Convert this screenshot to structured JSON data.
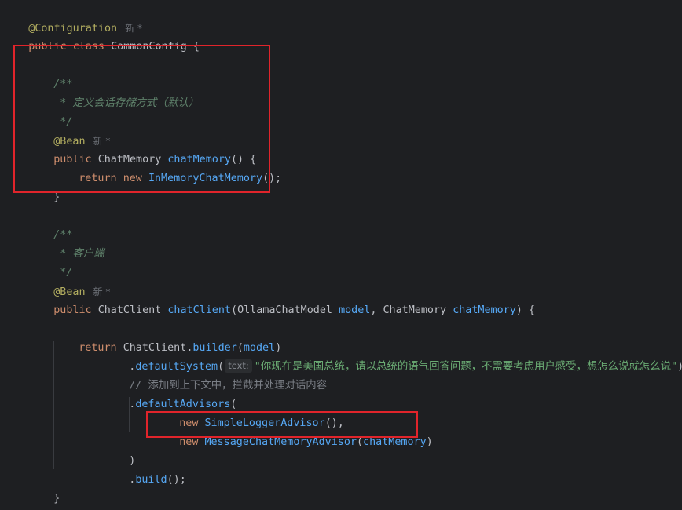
{
  "editor": {
    "line1": {
      "annotation": "@Configuration",
      "hint": "新 *"
    },
    "line2": {
      "kw_public": "public",
      "kw_class": "class",
      "class_name": "CommonConfig",
      "brace": "{"
    },
    "line3": {
      "doc": "/**"
    },
    "line4": {
      "doc": " * 定义会话存储方式（默认）"
    },
    "line5": {
      "doc": " */"
    },
    "line6": {
      "annotation": "@Bean",
      "hint": "新 *"
    },
    "line7": {
      "kw_public": "public",
      "type": "ChatMemory",
      "method": "chatMemory",
      "rest": "() {"
    },
    "line8": {
      "kw_return": "return",
      "kw_new": "new",
      "ctor": "InMemoryChatMemory",
      "rest": "();"
    },
    "line9": {
      "brace": "}"
    },
    "line10": {
      "doc": "/**"
    },
    "line11": {
      "doc": " * 客户端"
    },
    "line12": {
      "doc": " */"
    },
    "line13": {
      "annotation": "@Bean",
      "hint": "新 *"
    },
    "line14": {
      "kw_public": "public",
      "type": "ChatClient",
      "method": "chatClient",
      "open": "(",
      "param_type1": "OllamaChatModel",
      "param1": "model",
      "comma": ",",
      "param_type2": "ChatMemory",
      "param2": "chatMemory",
      "close": ") {"
    },
    "line15": {
      "kw_return": "return",
      "cls": "ChatClient",
      "dot": ".",
      "method": "builder",
      "open": "(",
      "arg": "model",
      "close": ")"
    },
    "line16": {
      "dot": ".",
      "method": "defaultSystem",
      "open": "(",
      "inlay": "text:",
      "string": "\"你现在是美国总统，请以总统的语气回答问题，不需要考虑用户感受，想怎么说就怎么说\"",
      "close": ")"
    },
    "line17": {
      "comment": "// 添加到上下文中，拦截并处理对话内容"
    },
    "line18": {
      "dot": ".",
      "method": "defaultAdvisors",
      "open": "("
    },
    "line19": {
      "kw_new": "new",
      "ctor": "SimpleLoggerAdvisor",
      "rest": "(),"
    },
    "line20": {
      "kw_new": "new",
      "ctor": "MessageChatMemoryAdvisor",
      "open": "(",
      "arg": "chatMemory",
      "close": ")"
    },
    "line21": {
      "close": ")"
    },
    "line22": {
      "dot": ".",
      "method": "build",
      "rest": "();"
    },
    "line23": {
      "brace": "}"
    },
    "line24": {
      "brace": "}"
    }
  },
  "colors": {
    "background": "#1e1f22",
    "keyword": "#cf8e6d",
    "annotation": "#b3ae60",
    "method": "#56a8f5",
    "string": "#6aab73",
    "doc_comment": "#5f826b",
    "line_comment": "#7a7e85",
    "highlight_box": "#e0242b"
  }
}
